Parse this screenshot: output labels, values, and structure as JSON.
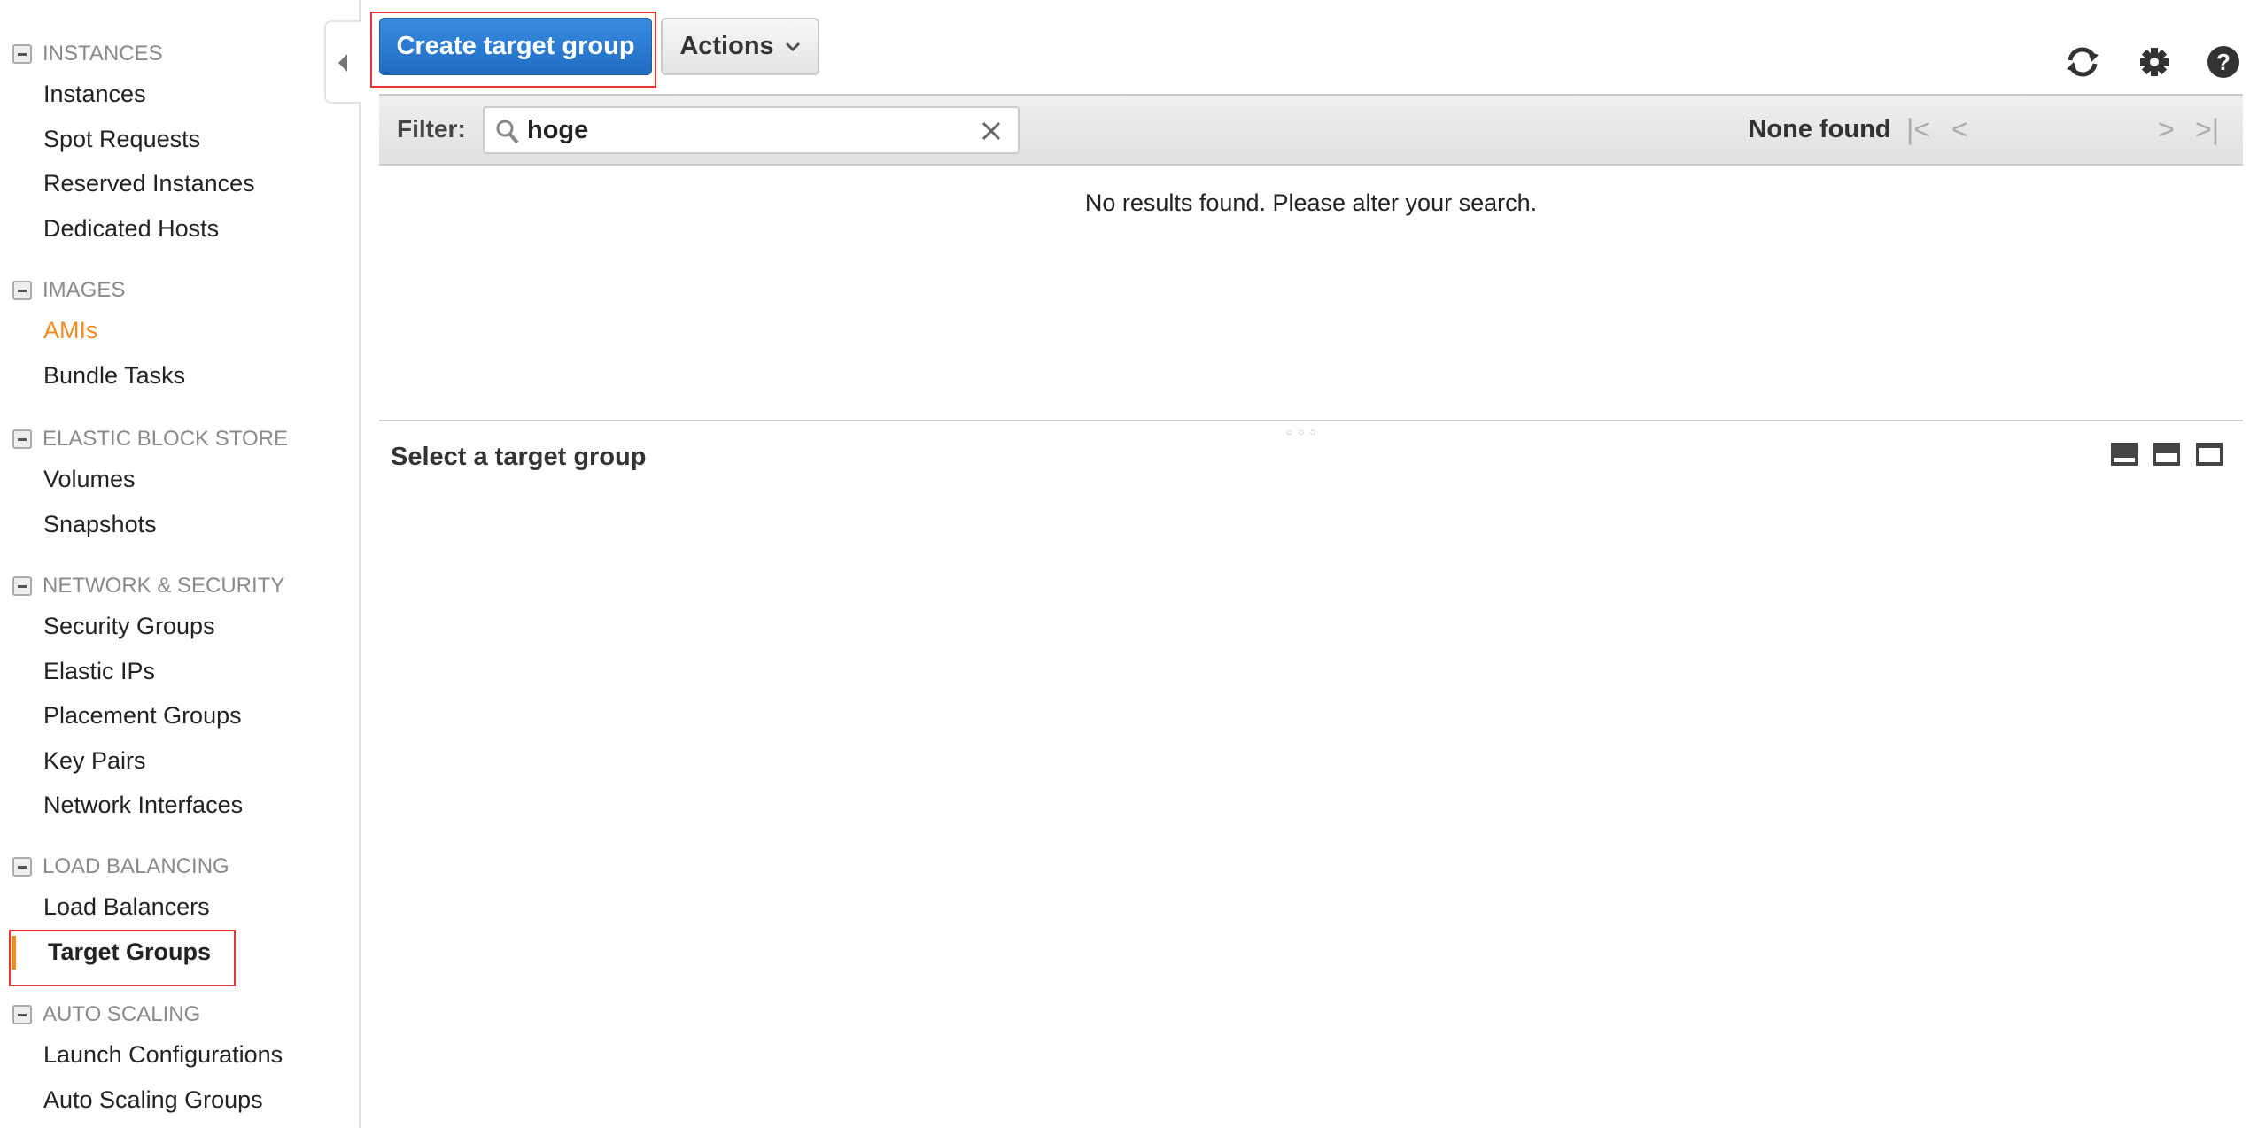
{
  "sidebar": {
    "sections": [
      {
        "title": "INSTANCES",
        "items": [
          "Instances",
          "Spot Requests",
          "Reserved Instances",
          "Dedicated Hosts"
        ]
      },
      {
        "title": "IMAGES",
        "items": [
          "AMIs",
          "Bundle Tasks"
        ]
      },
      {
        "title": "ELASTIC BLOCK STORE",
        "items": [
          "Volumes",
          "Snapshots"
        ]
      },
      {
        "title": "NETWORK & SECURITY",
        "items": [
          "Security Groups",
          "Elastic IPs",
          "Placement Groups",
          "Key Pairs",
          "Network Interfaces"
        ]
      },
      {
        "title": "LOAD BALANCING",
        "items": [
          "Load Balancers",
          "Target Groups"
        ]
      },
      {
        "title": "AUTO SCALING",
        "items": [
          "Launch Configurations",
          "Auto Scaling Groups"
        ]
      }
    ],
    "selected_item": "Target Groups",
    "highlighted_item": "AMIs"
  },
  "toolbar": {
    "create_label": "Create target group",
    "actions_label": "Actions"
  },
  "filter": {
    "label": "Filter:",
    "value": "hoge",
    "pagination": "None found"
  },
  "results": {
    "empty_message": "No results found. Please alter your search."
  },
  "detail": {
    "title": "Select a target group"
  },
  "colors": {
    "primary": "#2a7bd4",
    "accent": "#f58b1f",
    "highlight_box": "#e53935"
  }
}
